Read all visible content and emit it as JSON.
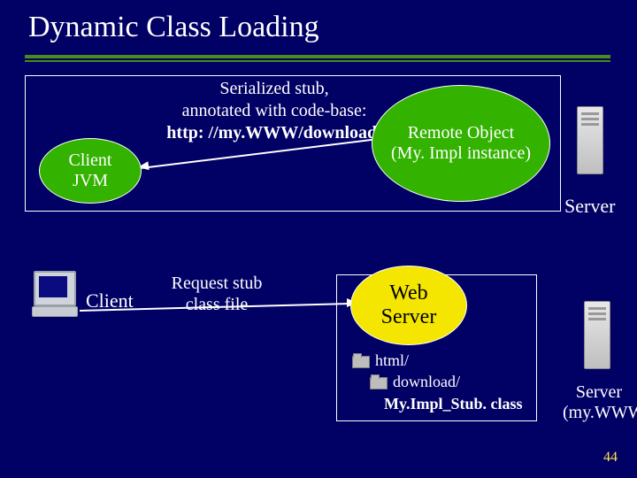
{
  "title": "Dynamic Class Loading",
  "serialized": {
    "l1": "Serialized stub,",
    "l2": "annotated with code-base:",
    "l3": "http: //my.WWW/download/"
  },
  "client_oval": {
    "l1": "Client",
    "l2": "JVM"
  },
  "remote_oval": {
    "l1": "Remote Object",
    "l2": "(My. Impl instance)"
  },
  "web_oval": {
    "l1": "Web",
    "l2": "Server"
  },
  "request": {
    "l1": "Request stub",
    "l2": "class file"
  },
  "labels": {
    "server": "Server",
    "client": "Client",
    "server2_l1": "Server",
    "server2_l2": "(my.WWW)"
  },
  "files": {
    "html": "html/",
    "download": "download/",
    "stub": "My.Impl_Stub. class"
  },
  "slide": "44"
}
